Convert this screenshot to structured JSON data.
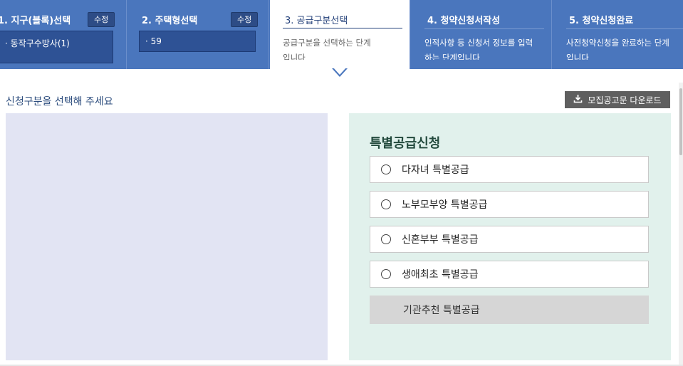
{
  "steps": [
    {
      "title": "1. 지구(블록)선택",
      "edit": "수정",
      "value": "·  동작구수방사(1)"
    },
    {
      "title": "2. 주택형선택",
      "edit": "수정",
      "value": "·  59"
    },
    {
      "title": "3. 공급구분선택",
      "desc": "공급구분을 선택하는 단계입니다"
    },
    {
      "title": "4. 청약신청서작성",
      "desc": "인적사항 등 신청서 정보를 입력하는 단계입니다"
    },
    {
      "title": "5. 청약신청완료",
      "desc": "사전청약신청을 완료하는 단계입니다"
    }
  ],
  "main": {
    "prompt": "신청구분을 선택해 주세요",
    "download_label": "모집공고문 다운로드"
  },
  "special": {
    "title": "특별공급신청",
    "options": [
      {
        "label": "다자녀 특별공급"
      },
      {
        "label": "노부모부양 특별공급"
      },
      {
        "label": "신혼부부 특별공급"
      },
      {
        "label": "생애최초 특별공급"
      },
      {
        "label": "기관추천 특별공급",
        "disabled": true
      }
    ]
  },
  "icons": {
    "download": "download-icon",
    "radio": "radio-icon"
  },
  "colors": {
    "header_bg": "#4a76bd",
    "panel_left": "#e2e4f3",
    "panel_right": "#e1f1ec"
  }
}
